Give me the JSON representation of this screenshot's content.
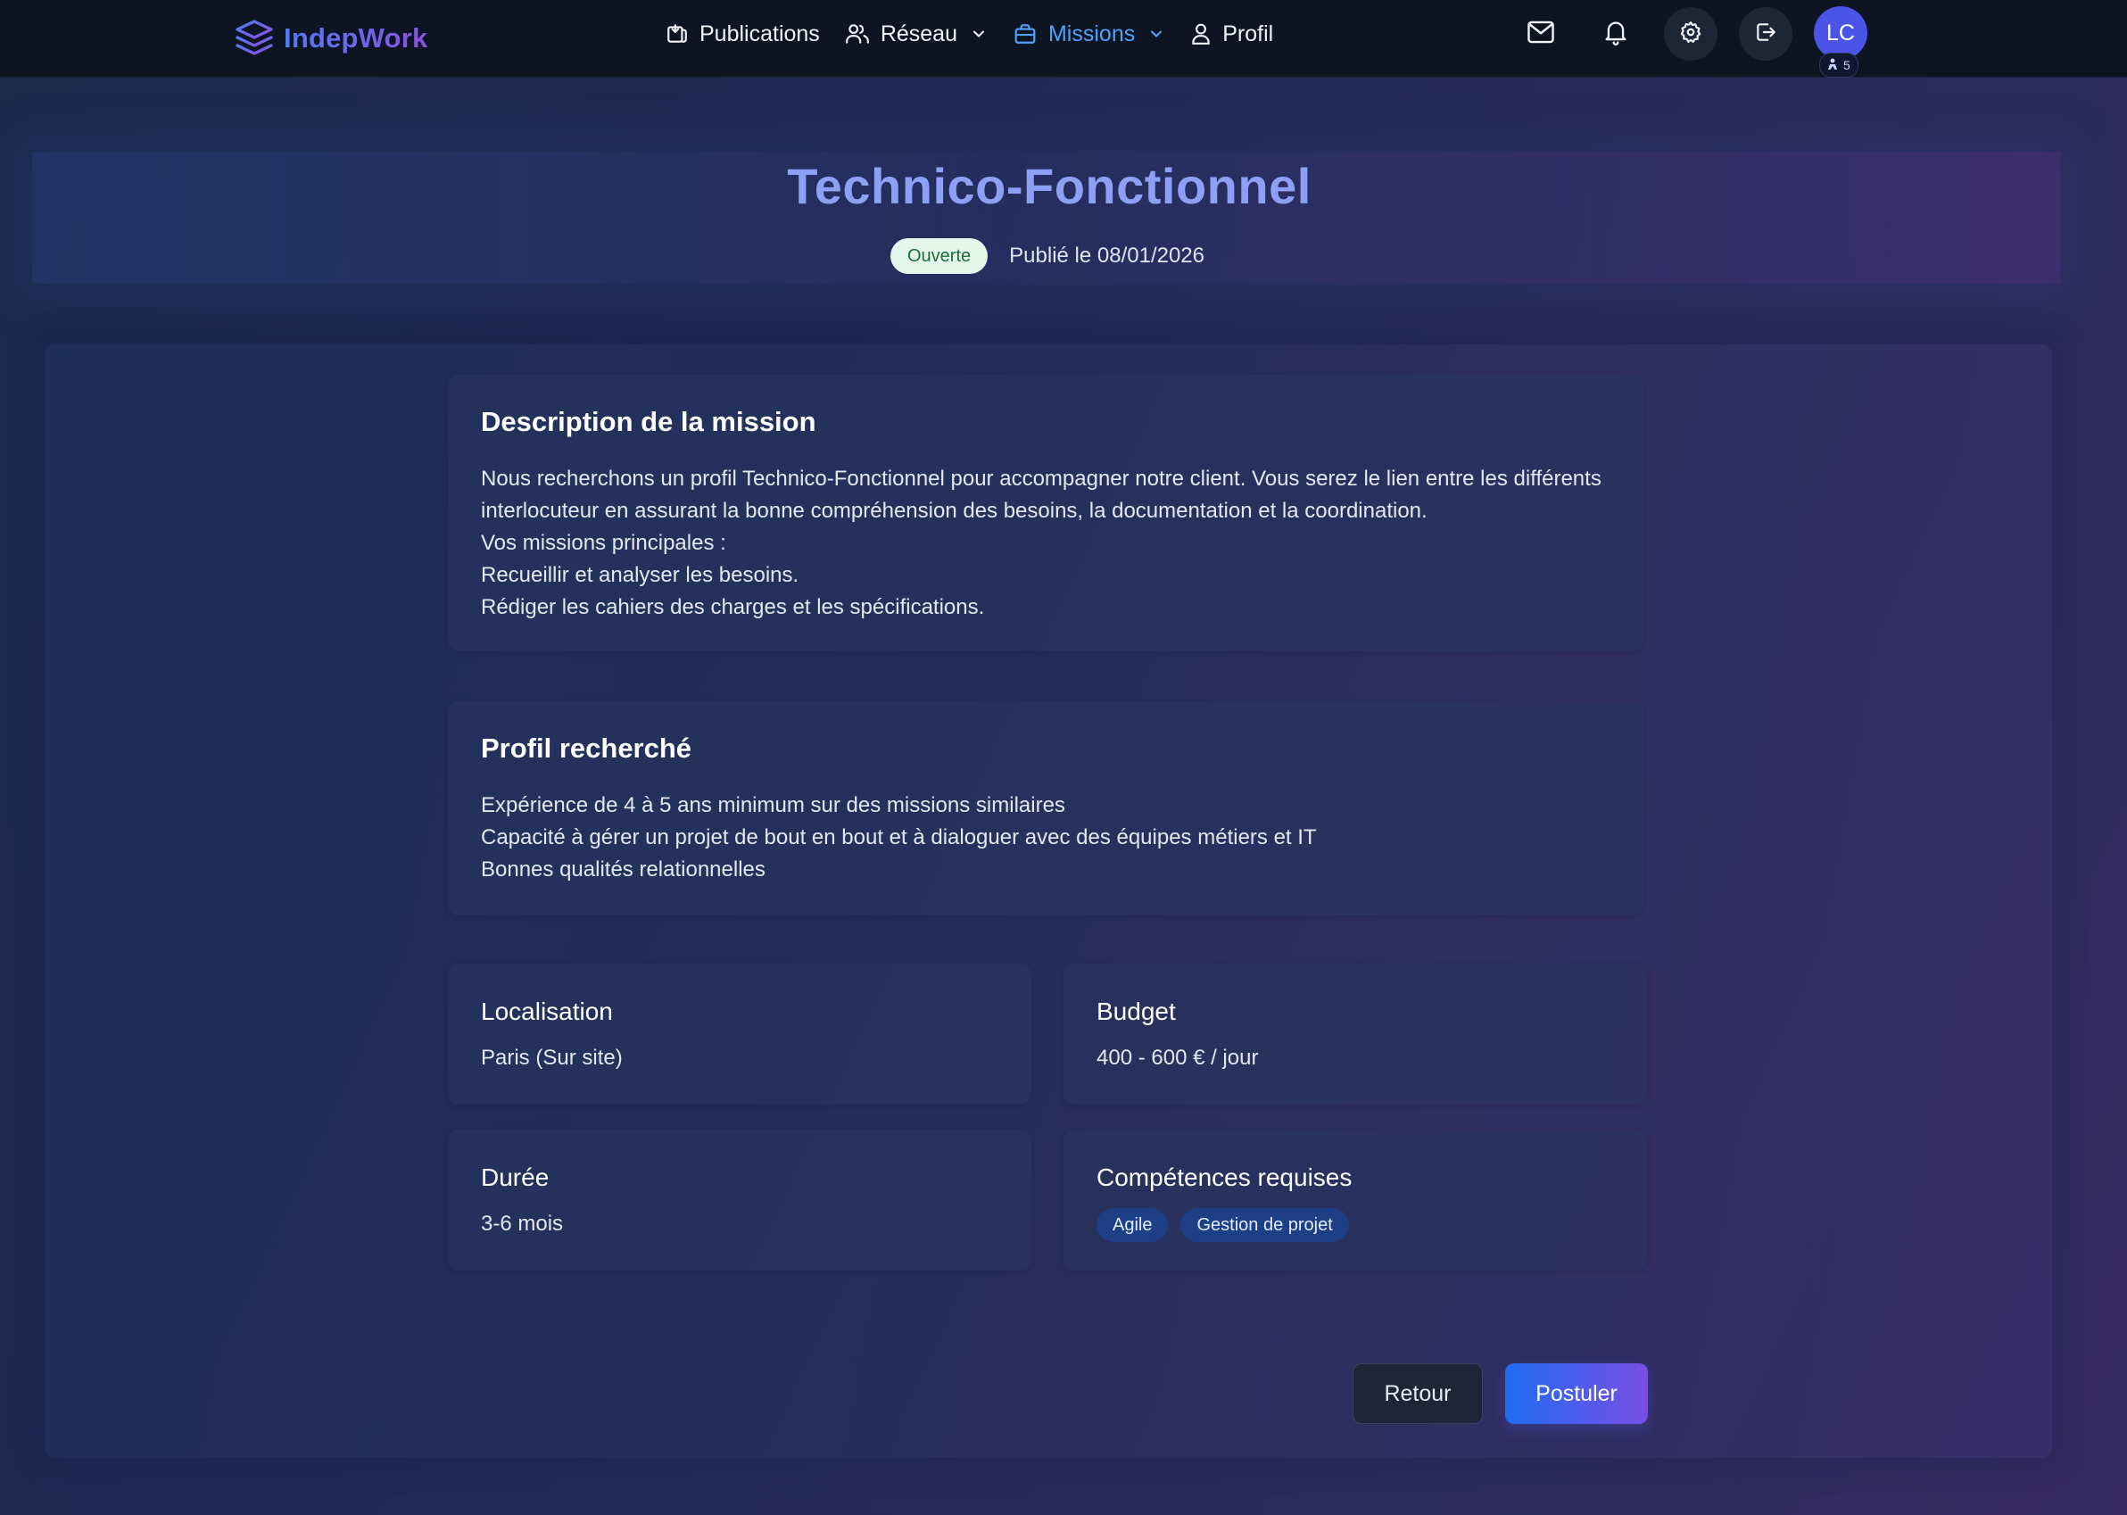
{
  "app": {
    "name": "IndepWork",
    "logo_icon": "layers-icon"
  },
  "nav": {
    "items": [
      {
        "label": "Publications",
        "icon": "publications-icon",
        "dropdown": false,
        "active": false
      },
      {
        "label": "Réseau",
        "icon": "users-icon",
        "dropdown": true,
        "active": false
      },
      {
        "label": "Missions",
        "icon": "briefcase-icon",
        "dropdown": true,
        "active": true
      },
      {
        "label": "Profil",
        "icon": "user-icon",
        "dropdown": false,
        "active": false
      }
    ],
    "right_icons": [
      "mail-icon",
      "bell-icon",
      "gear-icon",
      "logout-icon"
    ],
    "avatar_initials": "LC",
    "avatar_badge_count": "5",
    "active_color": "#4ea3ff"
  },
  "mission": {
    "title": "Technico-Fonctionnel",
    "status": "Ouverte",
    "published": "Publié le 08/01/2026",
    "description": {
      "heading": "Description de la mission",
      "lines": [
        "Nous recherchons un profil Technico-Fonctionnel pour accompagner notre client. Vous serez le lien entre les différents",
        "interlocuteur en assurant la bonne compréhension des besoins, la documentation et la coordination.",
        "Vos missions principales :",
        "Recueillir et analyser les besoins.",
        "Rédiger les cahiers des charges et les spécifications."
      ]
    },
    "profile": {
      "heading": "Profil recherché",
      "lines": [
        "Expérience de 4 à 5 ans minimum sur des missions similaires",
        "Capacité à gérer un projet de bout en bout et à dialoguer avec des équipes métiers et IT",
        "Bonnes qualités relationnelles"
      ]
    },
    "location": {
      "label": "Localisation",
      "value": "Paris (Sur site)"
    },
    "budget": {
      "label": "Budget",
      "value": "400 - 600 € / jour"
    },
    "duration": {
      "label": "Durée",
      "value": "3-6 mois"
    },
    "skills": {
      "label": "Compétences requises",
      "items": [
        "Agile",
        "Gestion de projet"
      ]
    }
  },
  "actions": {
    "back_label": "Retour",
    "apply_label": "Postuler"
  }
}
